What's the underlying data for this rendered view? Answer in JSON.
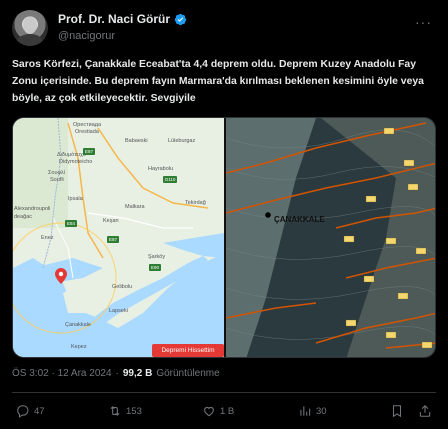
{
  "author": {
    "name": "Prof. Dr. Naci Görür",
    "handle": "@nacigorur",
    "more_glyph": "···"
  },
  "tweet": {
    "text": "Saros Körfezi, Çanakkale Eceabat'ta 4,4 deprem oldu. Deprem Kuzey Anadolu Fay Zonu içerisinde. Bu deprem fayın Marmara'da kırılması beklenen kesimini öyle veya böyle, az çok etkileyecektir. Sevgiyile"
  },
  "media": {
    "map_left": {
      "button_label": "Depremi Hissettim",
      "labels": {
        "l1": "Орестиада",
        "l2": "Orestiada",
        "l3": "Σουφλί",
        "l4": "Soufli",
        "l5": "Διδυμότειχο",
        "l6": "Didymoteicho",
        "l7": "Babaeski",
        "l8": "Lüleburgaz",
        "l9": "Hayrabolu",
        "l10": "Ipsala",
        "l11": "Keşan",
        "l12": "Tekirdağ",
        "l13": "Malkara",
        "l14": "Enez",
        "l15": "Şarköy",
        "l16": "Gelibolu",
        "l17": "Lapseki",
        "l18": "Çanakkale",
        "l19": "Kepez",
        "l20": "Alexandroupoli",
        "l21": "deağac"
      },
      "badges": {
        "b1": "E87",
        "b2": "D110",
        "b3": "E84",
        "b4": "E87",
        "b5": "E90"
      },
      "sea_color": "#aadaff",
      "land_color": "#e8f0e4",
      "marker_color": "#e53935"
    },
    "map_right": {
      "city_label": "ÇANAKKALE",
      "fault_color": "#d35400"
    }
  },
  "meta": {
    "time": "ÖS 3:02 · 12 Ara 2024",
    "separator": "·",
    "views_count": "99,2 B",
    "views_label": "Görüntülenme"
  },
  "actions": {
    "replies": "47",
    "reposts": "153",
    "likes": "1 B",
    "bookmarks": "30"
  },
  "colors": {
    "background": "#000000",
    "text": "#e7e9ea",
    "muted": "#71767b",
    "verified": "#1d9bf0"
  }
}
